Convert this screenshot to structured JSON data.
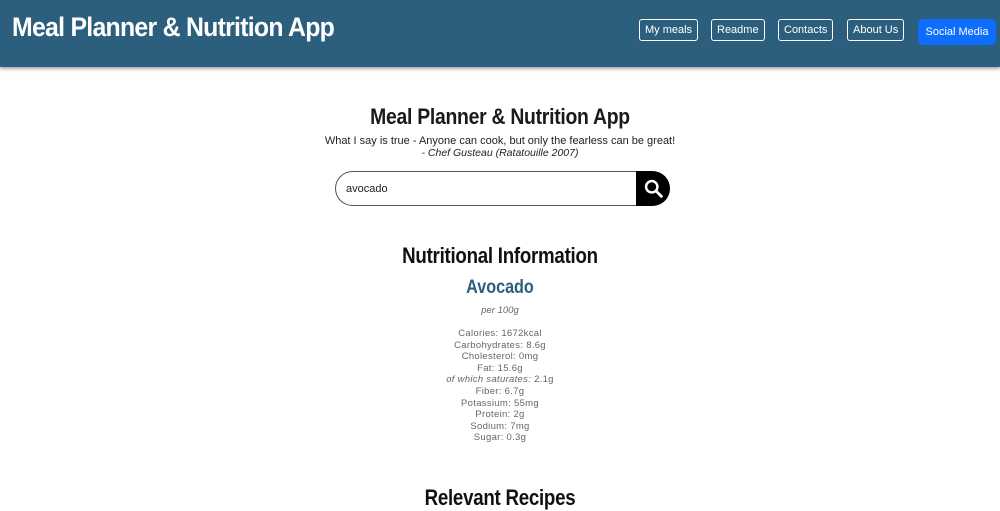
{
  "navbar": {
    "brand": "Meal Planner & Nutrition App",
    "links": [
      "My meals",
      "Readme",
      "Contacts",
      "About Us"
    ],
    "social_label": "Social Media"
  },
  "hero": {
    "title": "Meal Planner & Nutrition App",
    "quote": "What I say is true - Anyone can cook, but only the fearless can be great!",
    "author": "- Chef Gusteau (Ratatouille 2007)"
  },
  "search": {
    "value": "avocado",
    "button_icon": "search-icon"
  },
  "nutrition": {
    "section_title": "Nutritional Information",
    "food_name": "Avocado",
    "per": "per 100g",
    "items": [
      {
        "label": "Calories: ",
        "value": "1672kcal"
      },
      {
        "label": "Carbohydrates: ",
        "value": "8.6g"
      },
      {
        "label": "Cholesterol: ",
        "value": "0mg"
      },
      {
        "label": "Fat: ",
        "value": "15.6g"
      },
      {
        "label": "of which saturates: ",
        "value": "2.1g"
      },
      {
        "label": "Fiber: ",
        "value": "6.7g"
      },
      {
        "label": "Potassium: ",
        "value": "55mg"
      },
      {
        "label": "Protein: ",
        "value": "2g"
      },
      {
        "label": "Sodium: ",
        "value": "7mg"
      },
      {
        "label": "Sugar: ",
        "value": "0.3g"
      }
    ]
  },
  "recipes": {
    "section_title": "Relevant Recipes"
  },
  "colors": {
    "navbar": "#2c5f7e",
    "accent": "#0d6efd",
    "food_name": "#2c5f7e"
  }
}
